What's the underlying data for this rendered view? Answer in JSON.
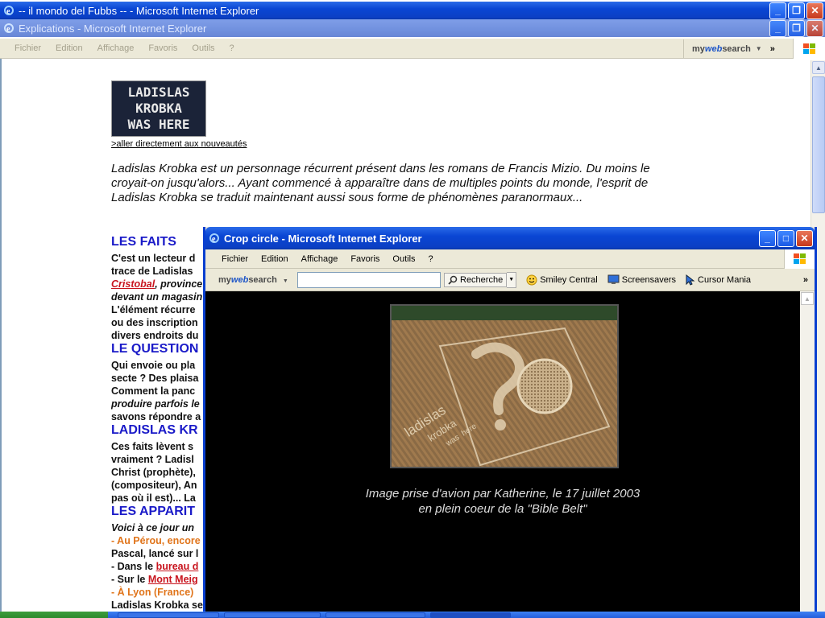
{
  "back_window": {
    "title": "-- il mondo del Fubbs -- - Microsoft Internet Explorer"
  },
  "main_window": {
    "title": "Explications - Microsoft Internet Explorer",
    "menu": [
      "Fichier",
      "Edition",
      "Affichage",
      "Favoris",
      "Outils",
      "?"
    ],
    "toolbar_brand": {
      "my": "my",
      "web": "web",
      "search": "search"
    }
  },
  "page": {
    "logo_lines": [
      "LADISLAS",
      "KROBKA",
      "WAS HERE"
    ],
    "news_link": ">aller directement aux nouveautés",
    "intro": "Ladislas Krobka est un personnage récurrent présent dans les romans de Francis Mizio. Du moins le croyait-on jusqu'alors... Ayant commencé à apparaître dans de multiples points du monde, l'esprit de Ladislas Krobka se traduit maintenant aussi sous forme de phénomènes paranormaux...",
    "sections": [
      "LES FAITS",
      "LE QUESTION",
      "LADISLAS KR",
      "LES APPARIT"
    ],
    "faits_lines": [
      "C'est un lecteur d",
      "trace de Ladislas",
      "Cristobal",
      ", province",
      "devant un magasin",
      "L'élément récurre",
      "ou des inscription",
      "divers endroits du"
    ],
    "question_lines": [
      "Qui envoie ou pla",
      "secte ? Des plaisa",
      "Comment la panc",
      "produire parfois le",
      "savons répondre a"
    ],
    "ladislas_lines": [
      "Ces faits lèvent s",
      "vraiment ? Ladisl",
      "Christ (prophète),",
      "(compositeur), An",
      "pas où il est)... La"
    ],
    "apparit_lines": [
      "Voici à ce jour un",
      "- Au Pérou, encore",
      "Pascal, lancé sur l",
      "- Dans le ",
      "bureau d",
      "- Sur le ",
      "Mont Meig",
      "- À Lyon (France)",
      "Ladislas Krobka se"
    ]
  },
  "popup": {
    "title": "Crop circle - Microsoft Internet Explorer",
    "menu": [
      "Fichier",
      "Edition",
      "Affichage",
      "Favoris",
      "Outils",
      "?"
    ],
    "search_button": "Recherche",
    "toolbar_items": [
      "Smiley Central",
      "Screensavers",
      "Cursor Mania"
    ],
    "more": "»",
    "photo_text": [
      "ladislas",
      "krobka",
      "was",
      "here"
    ],
    "caption_line1": "Image prise d'avion par Katherine, le 17 juillet 2003",
    "caption_line2": "en plein coeur de la \"Bible Belt\""
  },
  "colors": {
    "title_active": "#0a46d4",
    "title_inactive": "#7393e0",
    "section_blue": "#1a1ac8",
    "link_red": "#c8141e",
    "orange": "#e0741a"
  }
}
